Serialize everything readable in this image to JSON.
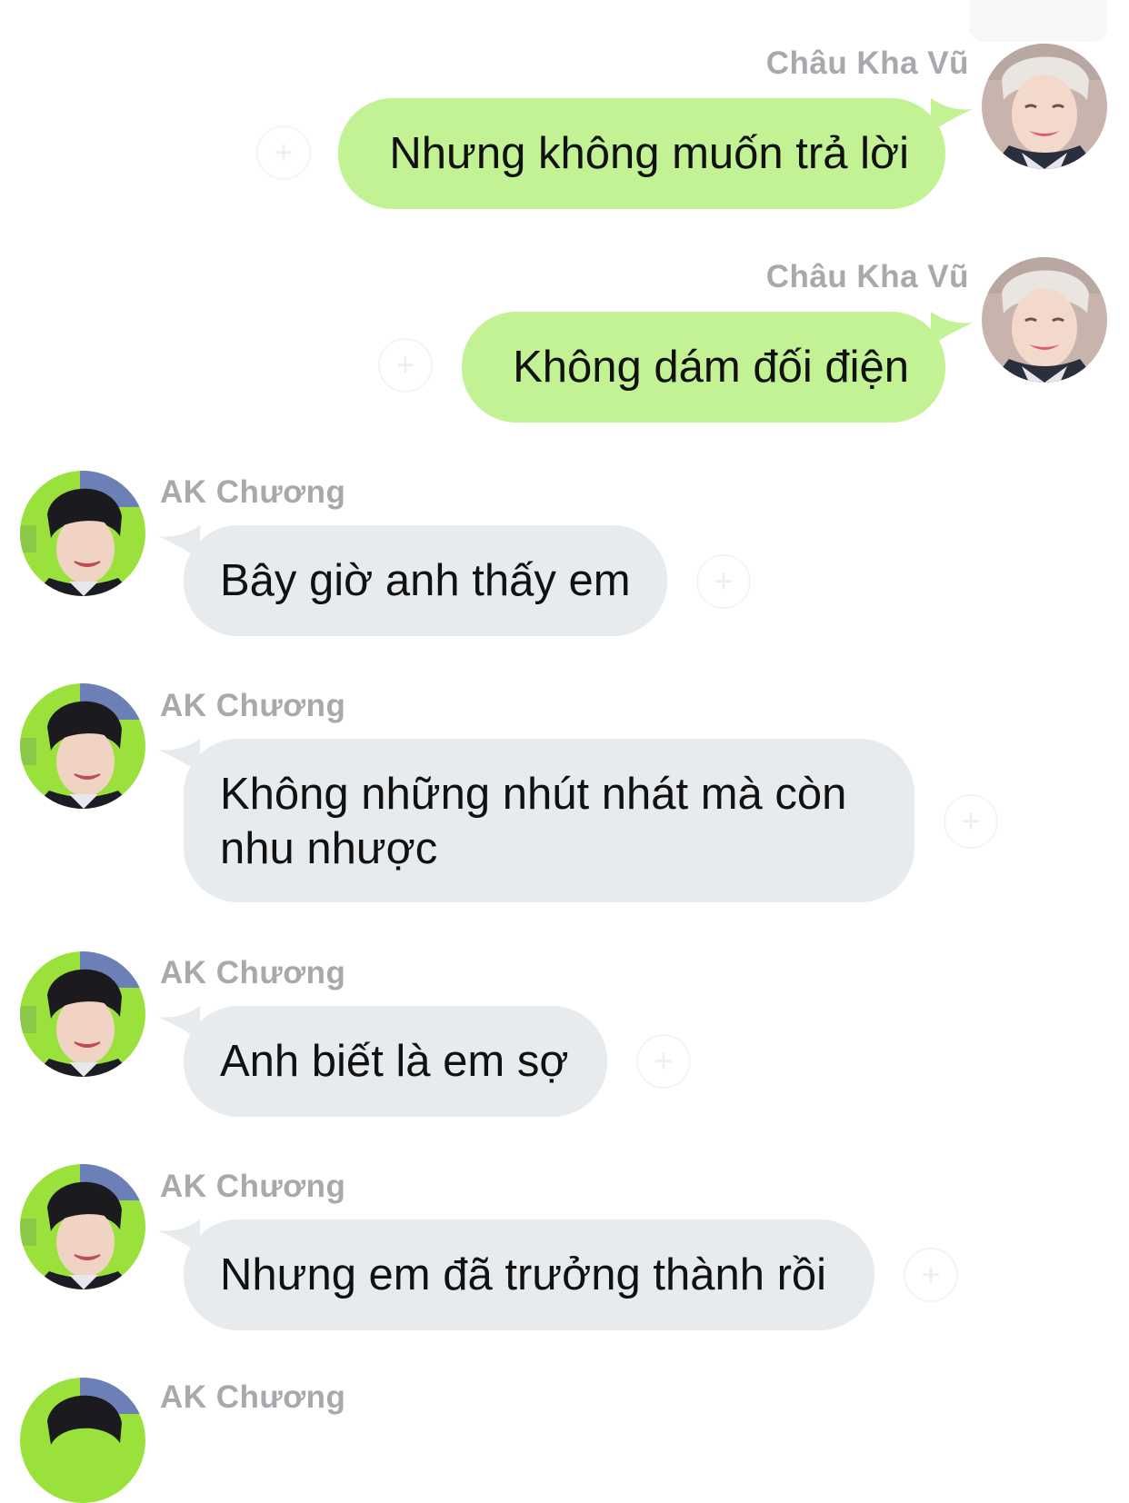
{
  "messages": [
    {
      "sender": "Châu Kha Vũ",
      "text": "Nhưng không muốn trả lời",
      "side": "out"
    },
    {
      "sender": "Châu Kha Vũ",
      "text": "Không dám đối điện",
      "side": "out"
    },
    {
      "sender": "AK Chương",
      "text": "Bây giờ anh thấy em",
      "side": "in"
    },
    {
      "sender": "AK Chương",
      "text": "Không những nhút nhát mà còn nhu nhược",
      "side": "in"
    },
    {
      "sender": "AK Chương",
      "text": "Anh biết là em sợ",
      "side": "in"
    },
    {
      "sender": "AK Chương",
      "text": "Nhưng em đã trưởng thành rồi",
      "side": "in"
    },
    {
      "sender": "AK Chương",
      "side": "in"
    }
  ],
  "react_glyph": "+",
  "colors": {
    "outgoing_bubble": "#c3f294",
    "incoming_bubble": "#e8ebee",
    "sender_name": "#a7a9ac",
    "incoming_avatar_bg": "#9be13c"
  },
  "icons": {
    "react": "add-reaction-icon",
    "avatar": "user-avatar"
  }
}
